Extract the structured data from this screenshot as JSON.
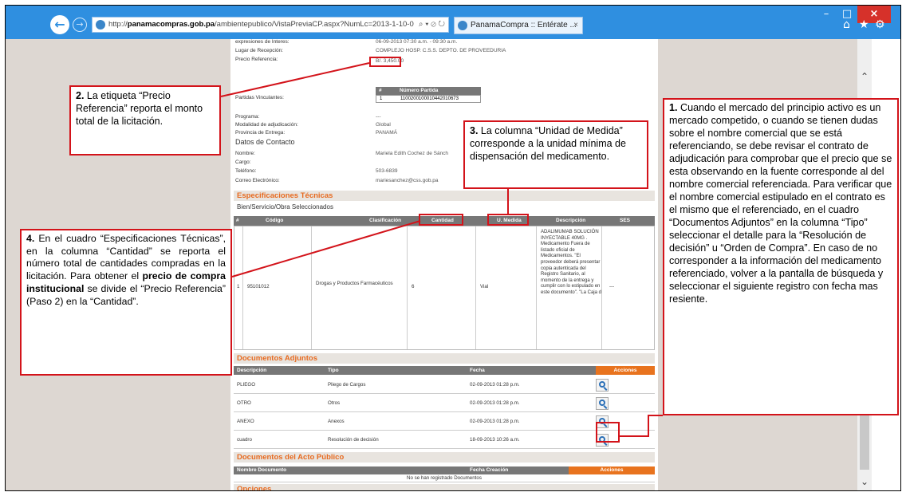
{
  "browser": {
    "url_prefix": "http://",
    "url_domain": "panamacompras.gob.pa",
    "url_path": "/ambientepublico/VistaPreviaCP.aspx?NumLc=2013-1-10-0",
    "url_tools": "⌕ ▾ ⊘ ↻",
    "tab_title": "PanamaCompra :: Entérate ...",
    "tab_close": "×",
    "back_icon": "←",
    "forward_icon": "→",
    "home_icon": "⌂",
    "star_icon": "★",
    "gear_icon": "⚙",
    "min_icon": "–",
    "max_icon": "□",
    "close_icon": "×"
  },
  "page": {
    "fields": {
      "expresiones_label": "expresiones de Interes:",
      "expresiones_value": "06-09-2013 07:30 a.m. - 09:30 a.m.",
      "lugar_label": "Lugar de Recepción:",
      "lugar_value": "COMPLEJO HOSP. C.S.S. DEPTO. DE PROVEEDURIA",
      "precio_label": "Precio Referencia:",
      "precio_value": "B/. 3,450.00",
      "partidas_label": "Partidas Vinculantes:",
      "programa_label": "Programa:",
      "programa_value": "---",
      "modalidad_label": "Modalidad de adjudicación:",
      "modalidad_value": "Global",
      "provincia_label": "Provincia de Entrega:",
      "provincia_value": "PANAMÁ",
      "datos_contacto": "Datos de Contacto",
      "nombre_label": "Nombre:",
      "nombre_value": "Mariela Edith Cochez de Sánch",
      "cargo_label": "Cargo:",
      "telefono_label": "Teléfono:",
      "telefono_value": "503-6839",
      "correo_label": "Correo Electrónico:",
      "correo_value": "mariesanchez@css.gob.pa"
    },
    "partida": {
      "col_num": "#",
      "col_numero": "Número Partida",
      "row_num": "1",
      "row_numero": "1100200100010442010673"
    },
    "specs": {
      "section_title": "Especificaciones Técnicas",
      "subtitle": "Bien/Servicio/Obra Seleccionados",
      "headers": [
        "#",
        "Código",
        "Clasificación",
        "Cantidad",
        "U. Medida",
        "Descripción",
        "SES"
      ],
      "row": {
        "num": "1",
        "codigo": "95101012",
        "clasificacion": "Drogas y Productos Farmacéuticos",
        "cantidad": "6",
        "unidad": "Vial",
        "descripcion": "ADALIMUMAB SOLUCIÓN INYECTABLE 40MG . Medicamento Fuera de listado oficial de Medicamentos. \"El proveedor deberá presentar copia autenticada del Registro Sanitario, al momento de la entrega y cumplir con lo estipulado en este documento\". \"La Caja d",
        "ses": "---"
      }
    },
    "docs": {
      "section_title": "Documentos Adjuntos",
      "headers": [
        "Descripción",
        "Tipo",
        "Fecha",
        "Acciones"
      ],
      "rows": [
        {
          "descripcion": "PLIEGO",
          "tipo": "Pliego de Cargos",
          "fecha": "02-09-2013 01:28 p.m."
        },
        {
          "descripcion": "OTRO",
          "tipo": "Otros",
          "fecha": "02-09-2013 01:28 p.m."
        },
        {
          "descripcion": "ANEXO",
          "tipo": "Anexos",
          "fecha": "02-09-2013 01:28 p.m."
        },
        {
          "descripcion": "cuadro",
          "tipo": "Resolución de decisión",
          "fecha": "18-09-2013 10:26 a.m."
        }
      ]
    },
    "acto": {
      "section_title": "Documentos del Acto Público",
      "headers": [
        "Nombre Documento",
        "Fecha Creación",
        "Acciones"
      ],
      "empty": "No se han registrado Documentos"
    },
    "opciones_title": "Opciones"
  },
  "annotations": {
    "c2_num": "2.",
    "c2_text": " La etiqueta “Precio Referencia” reporta el monto total de la licitación.",
    "c3_num": "3.",
    "c3_text": " La columna “Unidad de Medida” corresponde a la unidad mínima de dispensación del medicamento.",
    "c4_num": "4.",
    "c4_text_a": " En el cuadro “Especificaciones Técnicas”, en la columna “Cantidad” se reporta el número total de cantidades compradas en la licitación. Para obtener el ",
    "c4_bold": "precio de compra institucional",
    "c4_text_b": " se divide el “Precio Referencia” (Paso 2) en la “Cantidad”.",
    "c1_num": "1.",
    "c1_text": " Cuando el mercado del principio activo es un mercado competido, o cuando se tienen dudas sobre el nombre comercial que se está referenciando, se debe revisar el contrato de adjudicación para comprobar que el precio que se esta observando en la fuente corresponde al del nombre comercial referenciada. Para verificar que el nombre comercial estipulado en el contrato es el mismo que el referenciado, en el cuadro “Documentos Adjuntos” en la columna “Tipo” seleccionar el detalle para la “Resolución de decisión” u “Orden de Compra”. En caso de no corresponder a la información del medicamento referenciado, volver a la pantalla de búsqueda y seleccionar el siguiente registro con fecha mas resiente."
  },
  "colors": {
    "annotation_red": "#d3131a",
    "section_orange": "#e76a1f",
    "chrome_blue": "#2f8fe0"
  }
}
